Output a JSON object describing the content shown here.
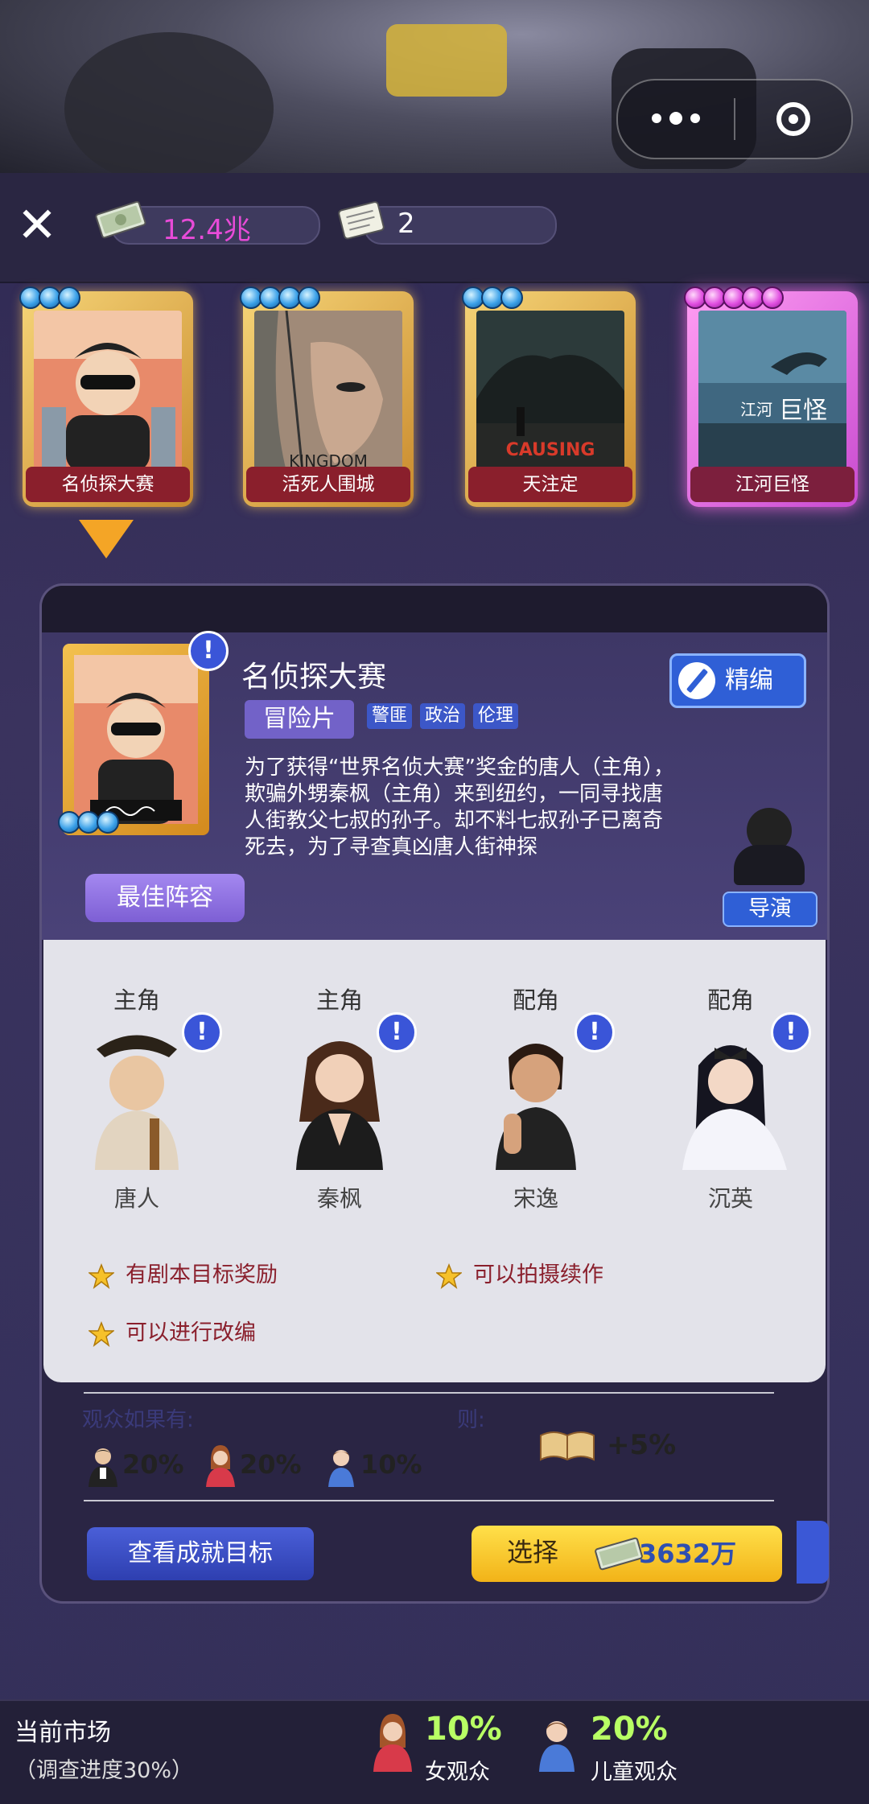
{
  "resources": {
    "money": "12.4兆",
    "scripts": "2"
  },
  "movies": [
    {
      "title": "名侦探大赛",
      "stars": 3,
      "rarity": "gold"
    },
    {
      "title": "活死人围城",
      "stars": 4,
      "rarity": "gold"
    },
    {
      "title": "天注定",
      "stars": 3,
      "rarity": "gold"
    },
    {
      "title": "江河巨怪",
      "stars": 5,
      "rarity": "pink"
    }
  ],
  "poster_texts": {
    "m2": "KINGDOM",
    "m3": "CAUSING",
    "m4a": "江河",
    "m4b": "巨怪"
  },
  "detail": {
    "title": "名侦探大赛",
    "genre": "冒险片",
    "tags": [
      "警匪",
      "政治",
      "伦理"
    ],
    "synopsis": "为了获得“世界名侦大赛”奖金的唐人（主角），欺骗外甥秦枫（主角）来到纽约，一同寻找唐人街教父七叔的孙子。却不料七叔孙子已离奇死去，为了寻查真凶唐人街神探",
    "edit_label": "精编",
    "best_cast_label": "最佳阵容",
    "director_label": "导演"
  },
  "cast": [
    {
      "role": "主角",
      "name": "唐人"
    },
    {
      "role": "主角",
      "name": "秦枫"
    },
    {
      "role": "配角",
      "name": "宋逸"
    },
    {
      "role": "配角",
      "name": "沉英"
    }
  ],
  "bonuses": [
    "有剧本目标奖励",
    "可以拍摄续作",
    "可以进行改编"
  ],
  "audience": {
    "if_label": "观众如果有:",
    "then_label": "则:",
    "items": [
      {
        "type": "male",
        "value": "20%"
      },
      {
        "type": "female",
        "value": "20%"
      },
      {
        "type": "child",
        "value": "10%"
      }
    ],
    "effect": "+5%"
  },
  "buttons": {
    "goals": "查看成就目标",
    "select": "选择",
    "cost": "3632万"
  },
  "market": {
    "title": "当前市场",
    "progress": "（调查进度30%）",
    "female_pct": "10%",
    "female_label": "女观众",
    "child_pct": "20%",
    "child_label": "儿童观众"
  },
  "colors": {
    "accent_gold": "#f4a526",
    "money": "#e84bd8",
    "market_pct": "#b8ff64"
  }
}
